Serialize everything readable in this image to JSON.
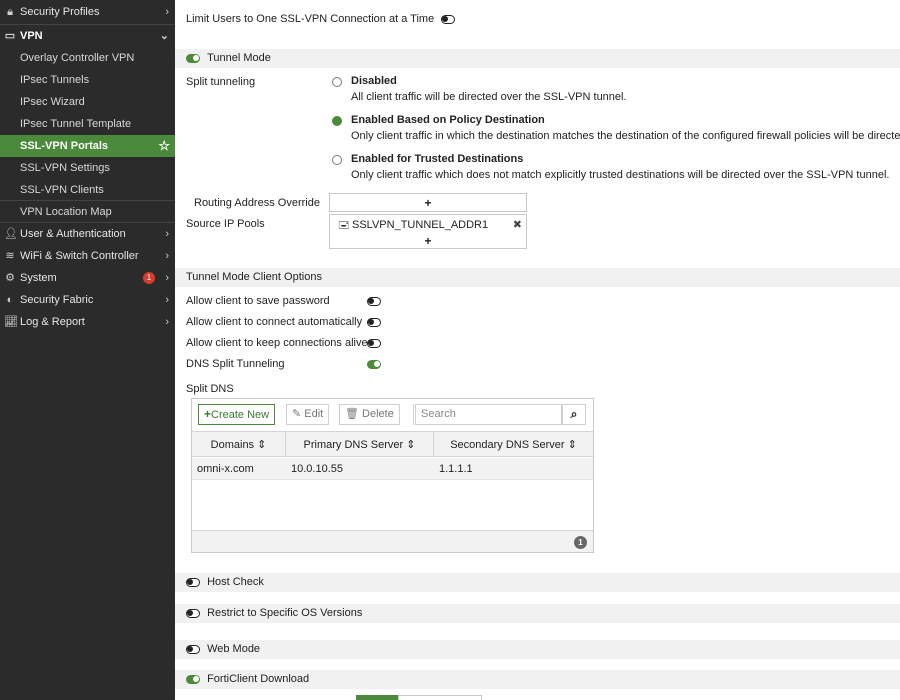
{
  "sidebar": {
    "items": [
      {
        "label": "Security Profiles",
        "icon": "lock-icon"
      },
      {
        "label": "VPN",
        "icon": "monitor-icon"
      },
      {
        "label": "Overlay Controller VPN"
      },
      {
        "label": "IPsec Tunnels"
      },
      {
        "label": "IPsec Wizard"
      },
      {
        "label": "IPsec Tunnel Template"
      },
      {
        "label": "SSL-VPN Portals"
      },
      {
        "label": "SSL-VPN Settings"
      },
      {
        "label": "SSL-VPN Clients"
      },
      {
        "label": "VPN Location Map"
      },
      {
        "label": "User & Authentication",
        "icon": "user-icon"
      },
      {
        "label": "WiFi & Switch Controller",
        "icon": "wifi-icon"
      },
      {
        "label": "System",
        "icon": "gear-icon",
        "badge": "1"
      },
      {
        "label": "Security Fabric",
        "icon": "fabric-icon"
      },
      {
        "label": "Log & Report",
        "icon": "chart-icon"
      }
    ],
    "accent": "#4a8a3a"
  },
  "main": {
    "limit_users_label": "Limit Users to One SSL-VPN Connection at a Time",
    "tunnel_mode_label": "Tunnel Mode",
    "split_tunneling_label": "Split tunneling",
    "split_options": [
      {
        "title": "Disabled",
        "desc": "All client traffic will be directed over the SSL-VPN tunnel."
      },
      {
        "title": "Enabled Based on Policy Destination",
        "desc": "Only client traffic in which the destination matches the destination of the configured firewall policies will be directed"
      },
      {
        "title": "Enabled for Trusted Destinations",
        "desc": "Only client traffic which does not match explicitly trusted destinations will be directed over the SSL-VPN tunnel."
      }
    ],
    "routing_override_label": "Routing Address Override",
    "source_ip_pools_label": "Source IP Pools",
    "source_ip_pool_entry": "SSLVPN_TUNNEL_ADDR1",
    "plus": "+",
    "remove": "✖",
    "client_options_label": "Tunnel Mode Client Options",
    "client_options": [
      {
        "label": "Allow client to save password"
      },
      {
        "label": "Allow client to connect automatically"
      },
      {
        "label": "Allow client to keep connections alive"
      },
      {
        "label": "DNS Split Tunneling"
      }
    ],
    "split_dns_label": "Split DNS",
    "dns_toolbar": {
      "create_new": "Create New",
      "edit": "Edit",
      "delete": "Delete",
      "search_placeholder": "Search"
    },
    "dns_table": {
      "headers": [
        "Domains ⇕",
        "Primary DNS Server ⇕",
        "Secondary DNS Server ⇕"
      ],
      "rows": [
        [
          "omni-x.com",
          "10.0.10.55",
          "1.1.1.1"
        ]
      ],
      "count": "1"
    },
    "host_check_label": "Host Check",
    "restrict_os_label": "Restrict to Specific OS Versions",
    "web_mode_label": "Web Mode",
    "forticlient_label": "FortiClient Download"
  }
}
